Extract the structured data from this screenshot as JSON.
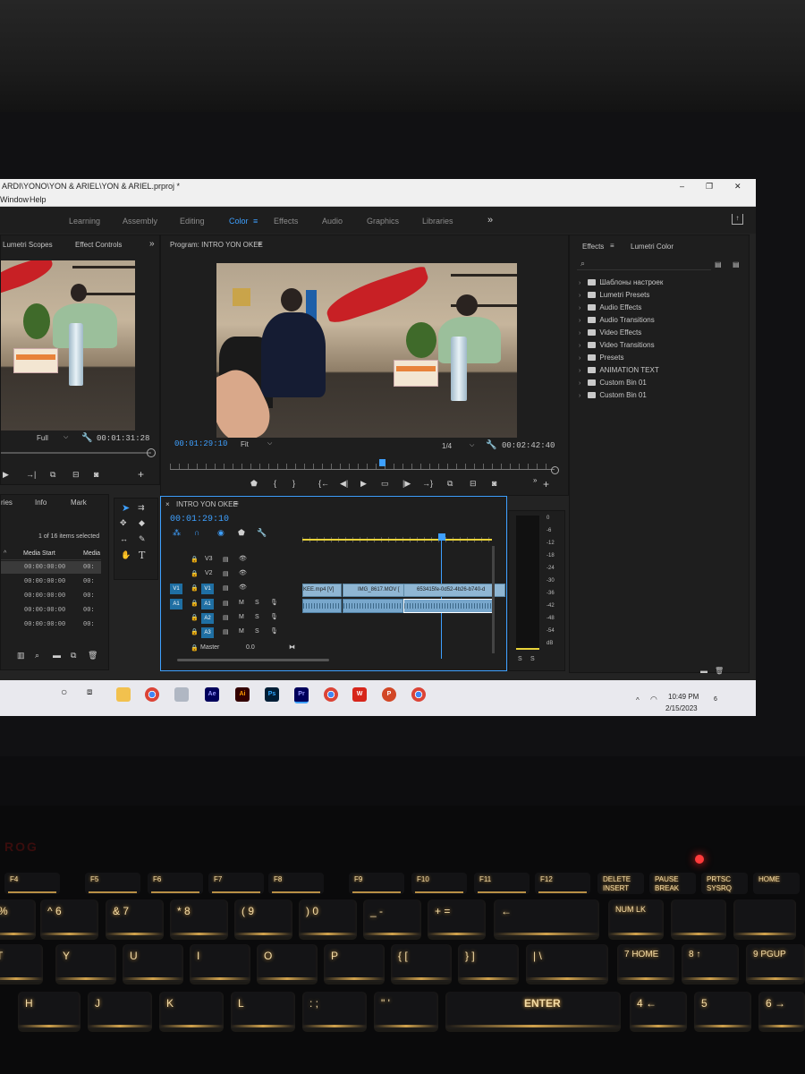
{
  "window": {
    "title": "ARDI\\YONO\\YON & ARIEL\\YON & ARIEL.prproj *",
    "controls": [
      "–",
      "❐",
      "✕"
    ]
  },
  "menu": [
    "Window",
    "Help"
  ],
  "workspaces": {
    "items": [
      "Learning",
      "Assembly",
      "Editing",
      "Color",
      "Effects",
      "Audio",
      "Graphics",
      "Libraries"
    ],
    "active": "Color",
    "more": "»"
  },
  "source_panel": {
    "tabs": [
      "Lumetri Scopes",
      "Effect Controls"
    ],
    "more": "»",
    "zoom": "Full",
    "timecode": "00:01:31:28"
  },
  "program_monitor": {
    "title": "Program: INTRO YON OKEE",
    "timecode": "00:01:29:10",
    "fit": "Fit",
    "resolution": "1/4",
    "duration": "00:02:42:40",
    "playhead_fraction": 0.55
  },
  "project_panel": {
    "tabs": [
      "ries",
      "Info",
      "Mark"
    ],
    "selection": "1 of 16 items selected",
    "columns": [
      "Media Start",
      "Media"
    ],
    "rows": [
      "00:00:00:00",
      "00:00:00:00",
      "00:00:00:00",
      "00:00:00:00",
      "00:00:00:00"
    ],
    "row_cut": "00:"
  },
  "timeline": {
    "sequence": "INTRO YON OKEE",
    "timecode": "00:01:29:10",
    "video_tracks": [
      "V3",
      "V2",
      "V1"
    ],
    "audio_tracks": [
      "A1",
      "A2",
      "A3"
    ],
    "source_patch_v": "V1",
    "source_patch_a": "A1",
    "master": "Master",
    "master_value": "0.0",
    "clips_video": [
      "KEE.mp4 [V]",
      "IMG_8617.MOV [",
      "653415fe-0d52-4b26-b740-d"
    ],
    "track_buttons": [
      "M",
      "S"
    ]
  },
  "audio_meter": {
    "scale": [
      "0",
      "-6",
      "-12",
      "-18",
      "-24",
      "-30",
      "-36",
      "-42",
      "-48",
      "-54",
      "dB"
    ],
    "solo": [
      "S",
      "S"
    ]
  },
  "effects_panel": {
    "tabs": [
      "Effects",
      "Lumetri Color"
    ],
    "items": [
      "Шаблоны настроек",
      "Lumetri Presets",
      "Audio Effects",
      "Audio Transitions",
      "Video Effects",
      "Video Transitions",
      "Presets",
      "ANIMATION TEXT",
      "Custom Bin 01",
      "Custom Bin 01"
    ]
  },
  "taskbar": {
    "apps": [
      "Ae",
      "Ai",
      "Ps",
      "Pr"
    ],
    "time": "10:49 PM",
    "date": "2/15/2023",
    "notifications": "6"
  },
  "keyboard": {
    "function_keys": [
      "F4",
      "F5",
      "F6",
      "F7",
      "F8",
      "F9",
      "F10",
      "F11",
      "F12",
      "DELETE",
      "PAUSE",
      "PRTSC",
      "HOME"
    ],
    "fn_sub": [
      "INSERT",
      "BREAK",
      "SYSRQ"
    ],
    "number_row": [
      "%",
      "^ 6",
      "& 7",
      "* 8",
      "( 9",
      ") 0",
      "_ -",
      "+ =",
      "←"
    ],
    "top_row": [
      "T",
      "Y",
      "U",
      "I",
      "O",
      "P",
      "{ [",
      "} ]",
      "| \\"
    ],
    "home_row": [
      "H",
      "J",
      "K",
      "L",
      ": ;",
      "\" '",
      "ENTER"
    ],
    "numpad": [
      "NUM LK",
      "7 HOME",
      "8 ↑",
      "9 PGUP",
      "4 ←",
      "5",
      "6 →"
    ],
    "brand": "ROG"
  },
  "colors": {
    "accent": "#3ea0ff",
    "key_glow": "#ffc55a",
    "clip_video": "#8fb6d3",
    "clip_audio": "#78a7cc",
    "in_out_bar": "#e8d23a"
  }
}
